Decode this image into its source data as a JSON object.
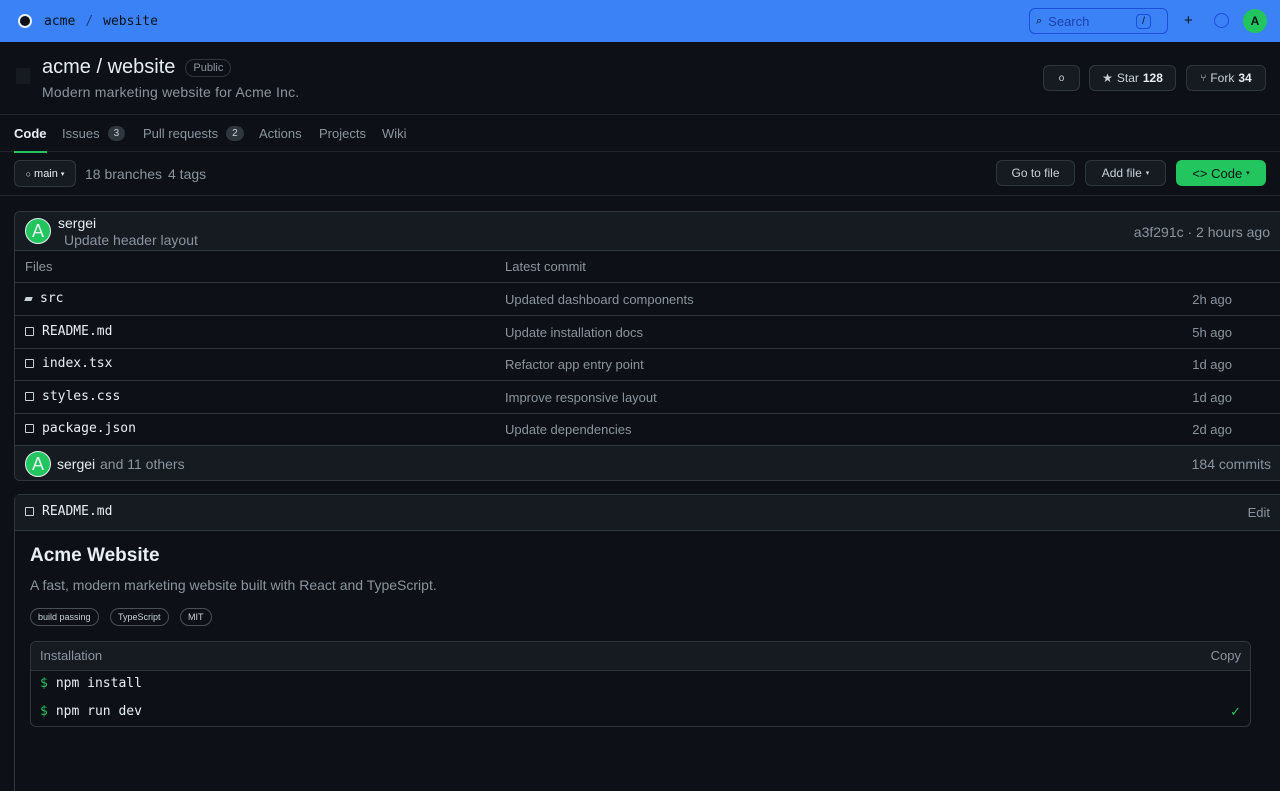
{
  "topbar": {
    "owner": "acme",
    "separator": "/",
    "repo": "website",
    "search_placeholder": "Search",
    "search_shortcut": "/",
    "new_icon": "+",
    "user_initial": "A"
  },
  "repo": {
    "title": "acme / website",
    "visibility": "Public",
    "description": "Modern marketing website for Acme Inc.",
    "watch_icon": "o",
    "star_label": "Star",
    "star_count": "128",
    "fork_label": "Fork",
    "fork_count": "34"
  },
  "tabs": [
    {
      "label": "Code"
    },
    {
      "label": "Issues",
      "count": "3"
    },
    {
      "label": "Pull requests",
      "count": "2"
    },
    {
      "label": "Actions"
    },
    {
      "label": "Projects"
    },
    {
      "label": "Wiki"
    }
  ],
  "branchbar": {
    "branch": "main",
    "branches": "18 branches",
    "tags": "4 tags",
    "go_to_file": "Go to file",
    "add_file": "Add file",
    "code_button": "<> Code"
  },
  "latest_commit": {
    "author": "sergei",
    "message": "Update header layout",
    "meta": "a3f291c · 2 hours ago",
    "avatar_initial": "A"
  },
  "file_table": {
    "col_files": "Files",
    "col_commit": "Latest commit",
    "rows": [
      {
        "name": "src",
        "type": "dir",
        "message": "Updated dashboard components",
        "when": "2h ago"
      },
      {
        "name": "README.md",
        "type": "file",
        "message": "Update installation docs",
        "when": "5h ago"
      },
      {
        "name": "index.tsx",
        "type": "file",
        "message": "Refactor app entry point",
        "when": "1d ago"
      },
      {
        "name": "styles.css",
        "type": "file",
        "message": "Improve responsive layout",
        "when": "1d ago"
      },
      {
        "name": "package.json",
        "type": "file",
        "message": "Update dependencies",
        "when": "2d ago"
      }
    ],
    "footer_author": "sergei",
    "footer_others": "and 11 others",
    "footer_commits": "184 commits"
  },
  "readme": {
    "filename": "README.md",
    "edit": "Edit",
    "heading": "Acme Website",
    "paragraph": "A fast, modern marketing website built with React and TypeScript.",
    "badges": [
      "build passing",
      "TypeScript",
      "MIT"
    ],
    "code_title": "Installation",
    "copy": "Copy",
    "prompt": "$",
    "commands": [
      "npm install",
      "npm run dev"
    ],
    "check": "✓"
  },
  "colors": {
    "topbar": "#3b82f6",
    "accent": "#22c55e",
    "bg": "#0d1117",
    "panel": "#161b22",
    "border": "#30363d"
  }
}
